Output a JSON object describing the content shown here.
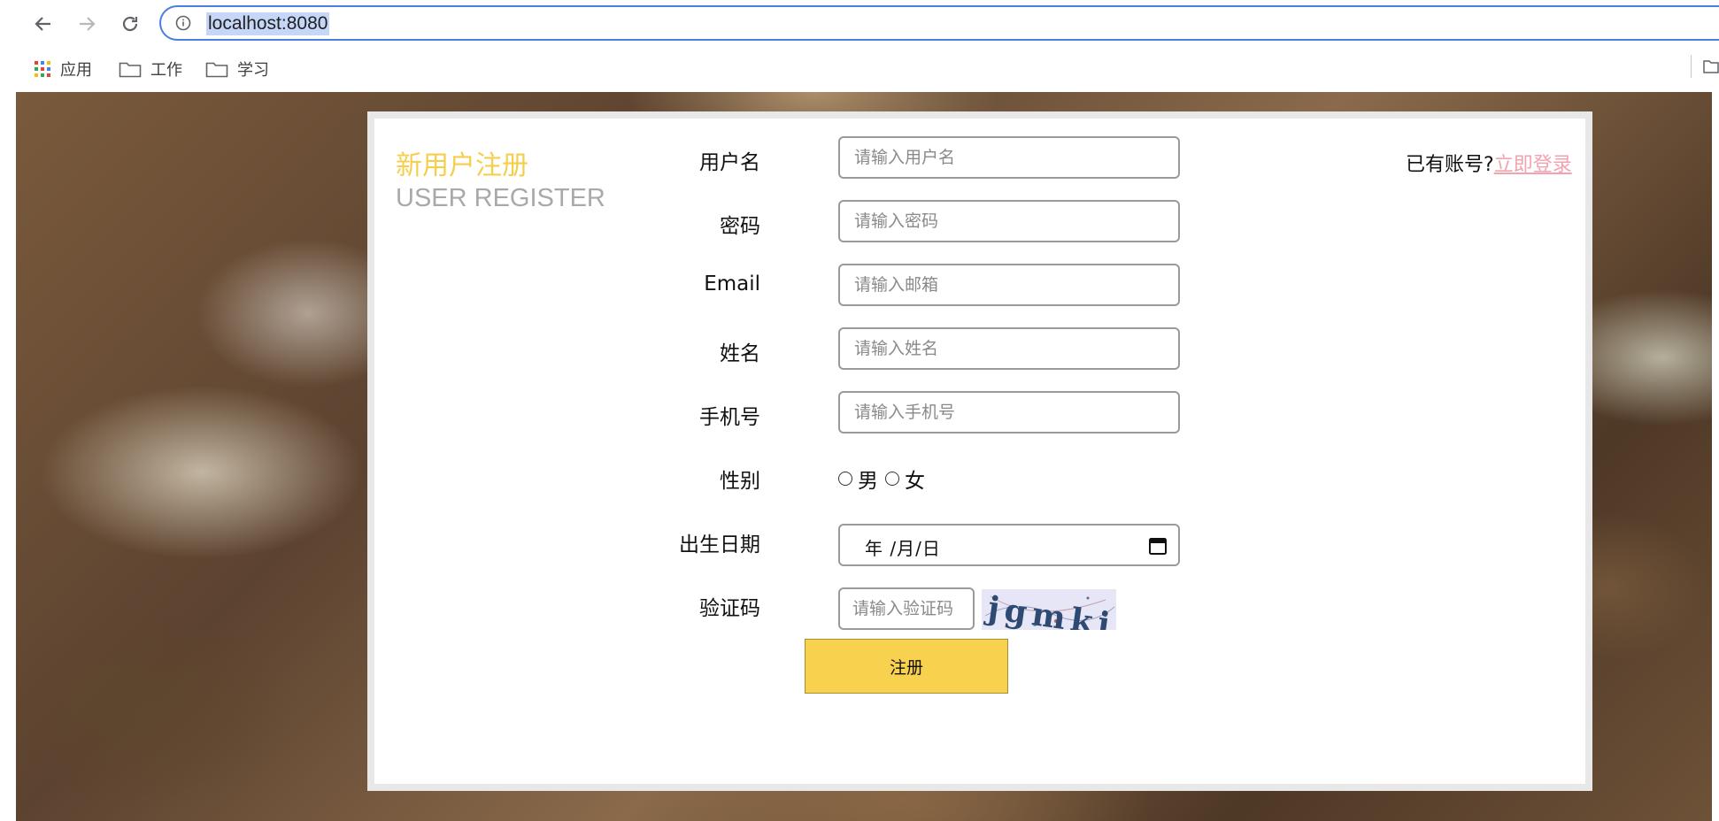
{
  "browser": {
    "url": "localhost:8080",
    "bookmarks": [
      {
        "label": "应用",
        "icon": "apps-grid-icon"
      },
      {
        "label": "工作",
        "icon": "folder-icon"
      },
      {
        "label": "学习",
        "icon": "folder-icon"
      }
    ]
  },
  "register": {
    "title_cn": "新用户注册",
    "title_en": "USER REGISTER",
    "login_prompt": "已有账号?",
    "login_link": "立即登录",
    "fields": {
      "username": {
        "label": "用户名",
        "placeholder": "请输入用户名"
      },
      "password": {
        "label": "密码",
        "placeholder": "请输入密码"
      },
      "email": {
        "label": "Email",
        "placeholder": "请输入邮箱"
      },
      "name": {
        "label": "姓名",
        "placeholder": "请输入姓名"
      },
      "phone": {
        "label": "手机号",
        "placeholder": "请输入手机号"
      },
      "gender": {
        "label": "性别",
        "options": [
          "男",
          "女"
        ]
      },
      "birthday": {
        "label": "出生日期",
        "value": "年 /月/日"
      },
      "captcha": {
        "label": "验证码",
        "placeholder": "请输入验证码",
        "image_text": "jgmkj"
      }
    },
    "submit_label": "注册",
    "colors": {
      "accent": "#f8d24e",
      "title": "#f5cf4c",
      "link": "#f2a3b0",
      "omnibox_border": "#4a7fe0"
    }
  }
}
